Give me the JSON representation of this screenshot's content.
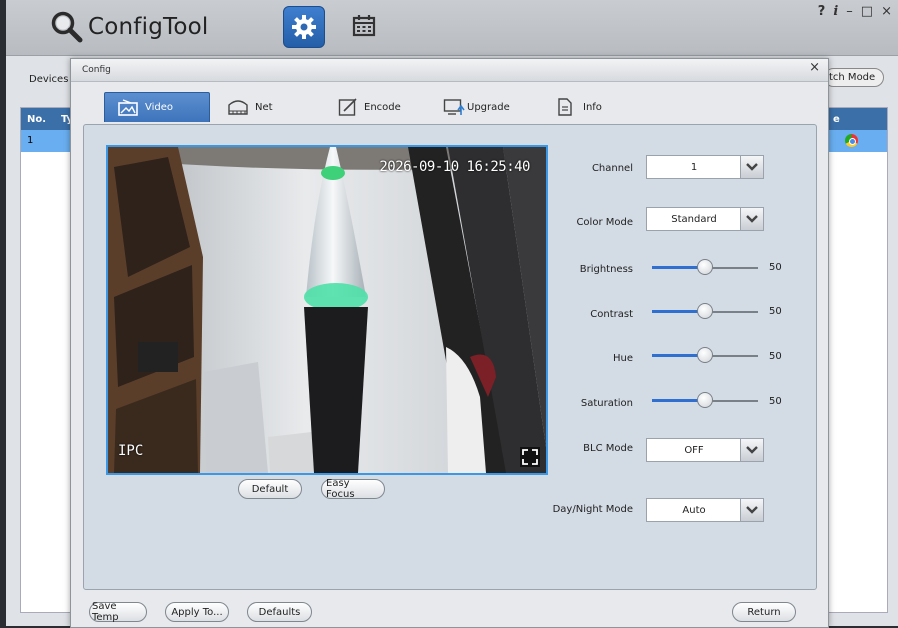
{
  "app": {
    "title": "ConfigTool",
    "controls": {
      "help": "?",
      "info": "i",
      "minimize": "–",
      "maximize": "□",
      "close": "×"
    }
  },
  "background": {
    "devices_label": "Devices",
    "batch_mode_label": "tch Mode",
    "grid_headers": {
      "no": "No.",
      "type": "Ty",
      "last": "e"
    },
    "row": {
      "no": "1"
    }
  },
  "dialog": {
    "title": "Config",
    "close": "×",
    "tabs": [
      {
        "label": "Video",
        "icon": "video-icon"
      },
      {
        "label": "Net",
        "icon": "network-icon"
      },
      {
        "label": "Encode",
        "icon": "encode-icon"
      },
      {
        "label": "Upgrade",
        "icon": "upgrade-icon"
      },
      {
        "label": "Info",
        "icon": "info-doc-icon"
      }
    ],
    "selected_tab": "Video",
    "preview": {
      "timestamp": "2026-09-10 16:25:40",
      "camera_name": "IPC"
    },
    "preview_buttons": {
      "default": "Default",
      "easy_focus": "Easy Focus"
    },
    "settings": {
      "channel": {
        "label": "Channel",
        "value": "1"
      },
      "color_mode": {
        "label": "Color Mode",
        "value": "Standard"
      },
      "brightness": {
        "label": "Brightness",
        "value": 50
      },
      "contrast": {
        "label": "Contrast",
        "value": 50
      },
      "hue": {
        "label": "Hue",
        "value": 50
      },
      "saturation": {
        "label": "Saturation",
        "value": 50
      },
      "blc_mode": {
        "label": "BLC Mode",
        "value": "OFF"
      },
      "day_night_mode": {
        "label": "Day/Night Mode",
        "value": "Auto"
      }
    },
    "footer": {
      "save_temp": "Save Temp",
      "apply_to": "Apply To...",
      "defaults": "Defaults",
      "return": "Return"
    }
  },
  "colors": {
    "accent": "#3e74bb",
    "selection": "#69aef0",
    "preview_border": "#3a98e6"
  }
}
